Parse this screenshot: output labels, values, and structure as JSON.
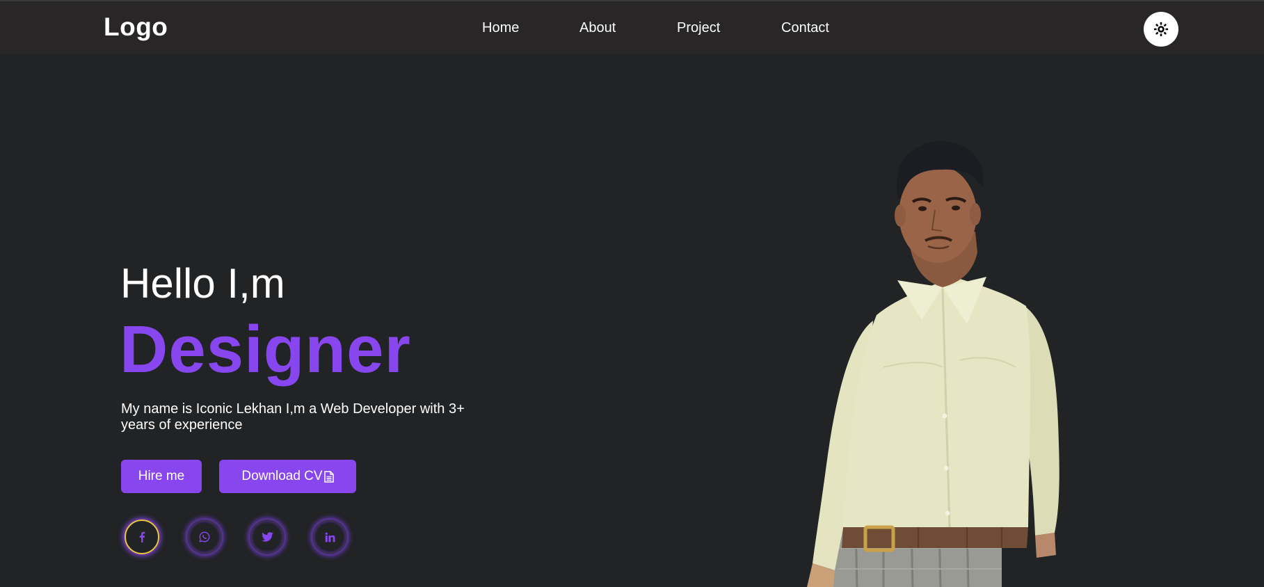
{
  "header": {
    "logo": "Logo",
    "nav": [
      {
        "label": "Home"
      },
      {
        "label": "About"
      },
      {
        "label": "Project"
      },
      {
        "label": "Contact"
      }
    ],
    "theme_toggle_icon": "sun-icon"
  },
  "hero": {
    "greeting": "Hello I,m",
    "role": "Designer",
    "description": "My name is Iconic Lekhan I,m a Web Developer with 3+ years of experience",
    "hire_button": "Hire me",
    "cv_button": "Download CV",
    "cv_icon": "file-icon"
  },
  "social": [
    {
      "icon": "facebook-icon"
    },
    {
      "icon": "whatsapp-icon"
    },
    {
      "icon": "twitter-icon"
    },
    {
      "icon": "linkedin-icon"
    }
  ],
  "colors": {
    "accent": "#8746ee",
    "background": "#212325",
    "header": "#282627",
    "facebook_ring": "#e7c63a"
  }
}
